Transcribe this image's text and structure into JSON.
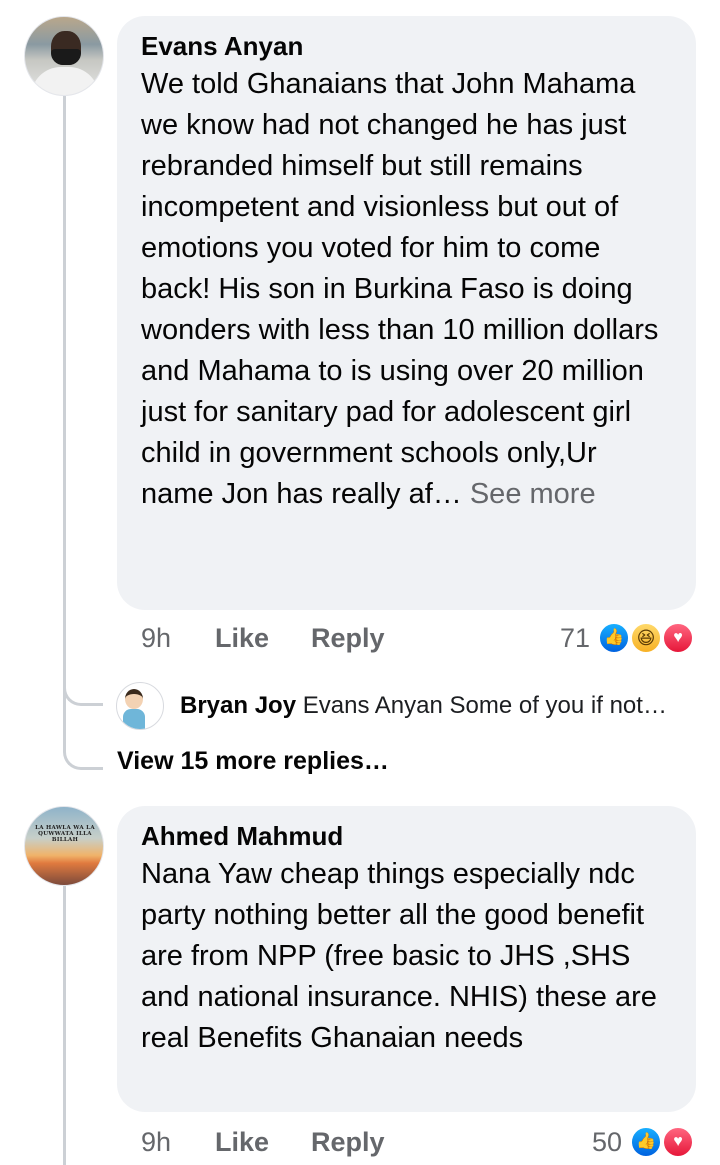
{
  "comments": [
    {
      "author": "Evans Anyan",
      "text": "We told Ghanaians that John Mahama we know had not changed he has just rebranded himself but still remains incompetent and visionless but out of emotions you voted for him to come back! His son in Burkina Faso is doing wonders with less than 10 million dollars and Mahama to is using over 20 million just for sanitary pad for adolescent girl child in government schools only,Ur name Jon has really af…",
      "see_more": "See more",
      "time": "9h",
      "like_label": "Like",
      "reply_label": "Reply",
      "reaction_count": "71",
      "reactions": [
        "like-icon",
        "haha-icon",
        "love-icon"
      ]
    },
    {
      "author": "Ahmed Mahmud",
      "text": "Nana Yaw cheap things especially ndc party nothing better all the good benefit are from NPP (free basic to JHS ,SHS and national insurance. NHIS) these are real Benefits Ghanaian needs",
      "time": "9h",
      "like_label": "Like",
      "reply_label": "Reply",
      "reaction_count": "50",
      "reactions": [
        "like-icon",
        "love-icon"
      ]
    }
  ],
  "reply_preview": {
    "author": "Bryan Joy",
    "text": "Evans Anyan Some of you if not…"
  },
  "view_more_replies": "View 15 more replies…",
  "ahmed_avatar_text": "LA HAWLA WA LA QUWWATA ILLA BILLAH"
}
